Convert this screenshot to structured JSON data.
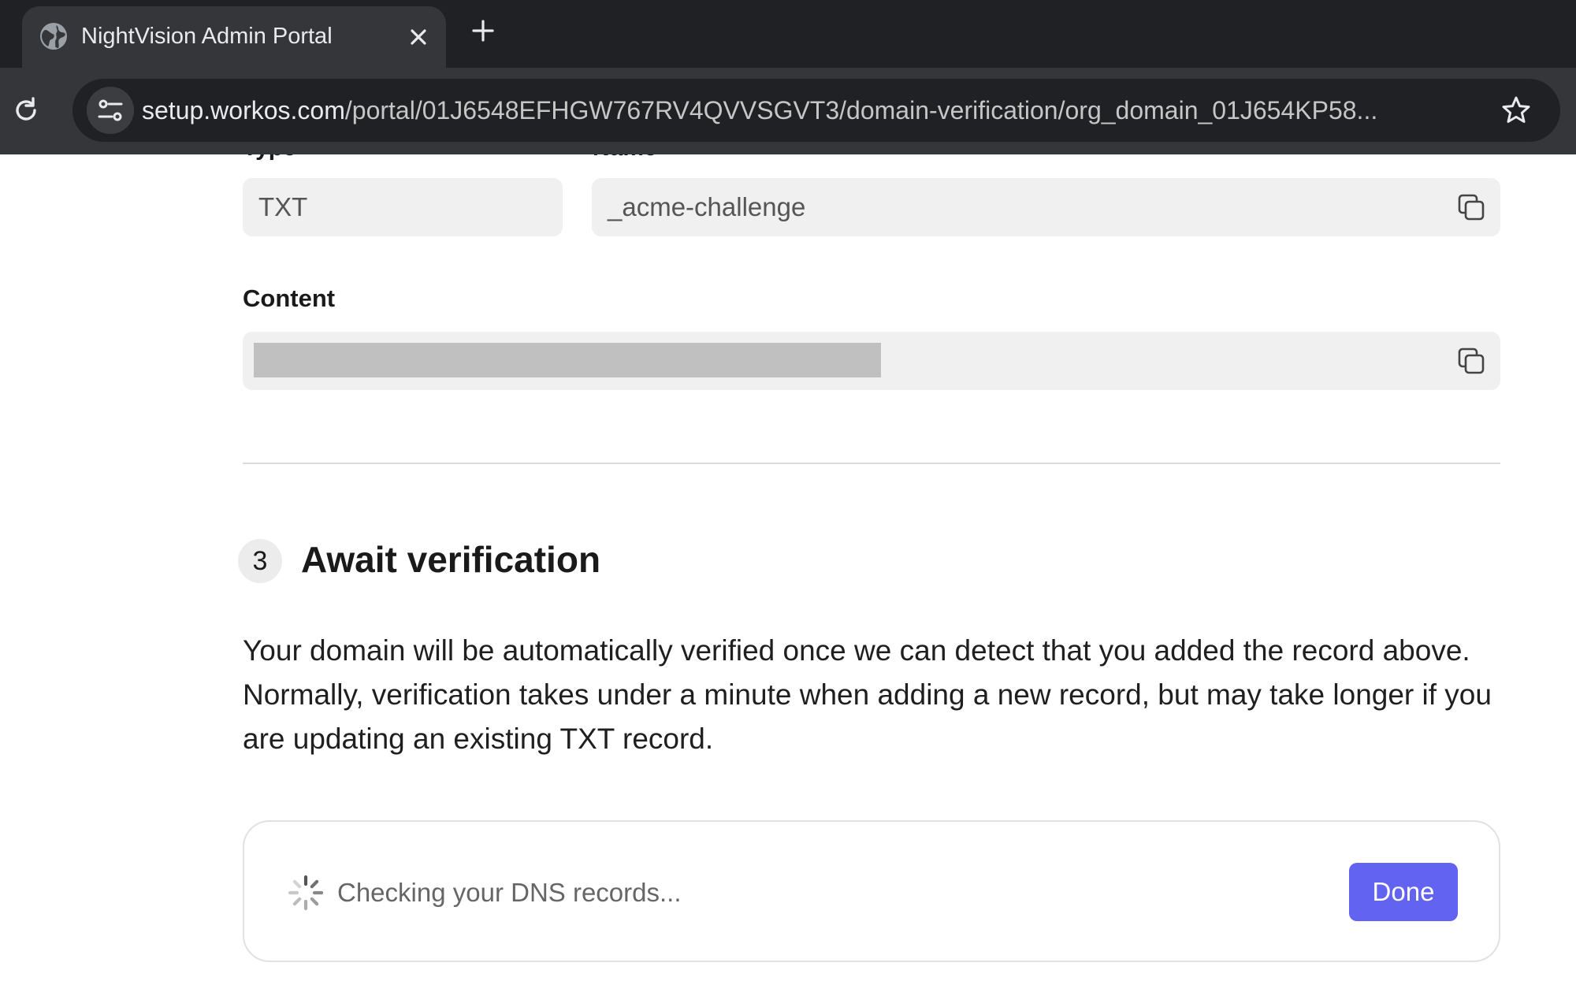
{
  "browser": {
    "tab": {
      "title": "NightVision Admin Portal"
    },
    "address_bar": {
      "host": "setup.workos.com",
      "path": "/portal/01J6548EFHGW767RV4QVVSGVT3/domain-verification/org_domain_01J654KP58..."
    }
  },
  "record": {
    "type_value": "TXT",
    "name_value": "_acme-challenge",
    "content_label": "Content"
  },
  "step3": {
    "number": "3",
    "title": "Await verification",
    "description": "Your domain will be automatically verified once we can detect that you added the record above. Normally, verification takes under a minute when adding a new record, but may take longer if you are updating an existing TXT record."
  },
  "status": {
    "text": "Checking your DNS records...",
    "done_label": "Done"
  },
  "colors": {
    "primary_button": "#6363f1",
    "field_background": "#f0f0f0"
  }
}
